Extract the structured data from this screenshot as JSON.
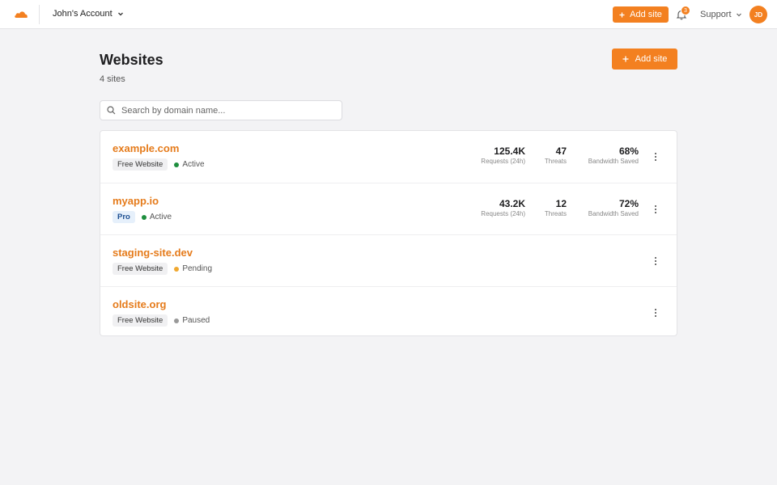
{
  "header": {
    "account_name": "John's Account",
    "add_site_label": "Add site",
    "notification_count": "3",
    "support_label": "Support",
    "avatar_initials": "JD"
  },
  "main": {
    "title": "Websites",
    "site_count": "4 sites",
    "add_site_label": "Add site",
    "search": {
      "placeholder": "Search by domain name..."
    }
  },
  "sites": [
    {
      "domain": "example.com",
      "plan": "Free Website",
      "status": "Active",
      "status_color": "#1e8e3e",
      "stats": [
        {
          "value": "125.4K",
          "label": "Requests (24h)"
        },
        {
          "value": "47",
          "label": "Threats"
        },
        {
          "value": "68%",
          "label": "Bandwidth Saved"
        }
      ]
    },
    {
      "domain": "myapp.io",
      "plan": "Pro",
      "status": "Active",
      "status_color": "#1e8e3e",
      "stats": [
        {
          "value": "43.2K",
          "label": "Requests (24h)"
        },
        {
          "value": "12",
          "label": "Threats"
        },
        {
          "value": "72%",
          "label": "Bandwidth Saved"
        }
      ]
    },
    {
      "domain": "staging-site.dev",
      "plan": "Free Website",
      "status": "Pending",
      "status_color": "#f0a830"
    },
    {
      "domain": "oldsite.org",
      "plan": "Free Website",
      "status": "Paused",
      "status_color": "#999999"
    }
  ],
  "colors": {
    "accent": "#f38020",
    "link": "#e57b1b"
  }
}
